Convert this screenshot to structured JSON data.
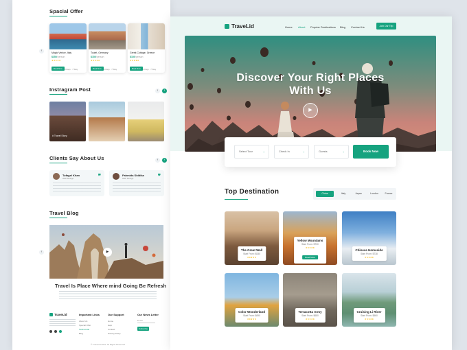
{
  "left": {
    "special_offer": {
      "title": "Spacial Offer",
      "cards": [
        {
          "name": "Magic Venice, Italy",
          "price": "$350",
          "per": "/person",
          "button": "Book Now",
          "meta": "4 Days · 7 Stay"
        },
        {
          "name": "Toulet, Germany",
          "price": "$150",
          "per": "/person",
          "button": "Book Now",
          "meta": "4 Days · 7 Stay"
        },
        {
          "name": "Greek Cottage, Greece",
          "price": "$150",
          "per": "/person",
          "button": "Book Now",
          "meta": "4 Days · 7 Stay"
        }
      ]
    },
    "instagram": {
      "title": "Instragram Post",
      "first_label": "# Travel Story"
    },
    "clients": {
      "title": "Clients Say About Us",
      "items": [
        {
          "name": "Tufagel Khan",
          "role": "Web Design"
        },
        {
          "name": "Fahmida Siddika",
          "role": "Web Design"
        }
      ]
    },
    "blog": {
      "title": "Travel Blog",
      "post_title": "Travel Is Place Where mind Going Be Refresh"
    },
    "footer": {
      "brand": "TraveLid",
      "columns": [
        {
          "title": "Important Links",
          "links": [
            "About Us",
            "Special Offer",
            "Testimonial",
            "Blog"
          ]
        },
        {
          "title": "Our Support",
          "links": [
            "Home",
            "Help",
            "Contact",
            "Privacy Policy"
          ]
        },
        {
          "title": "Our News Letter",
          "input_placeholder": "Email",
          "button": "Subscribe"
        }
      ],
      "copyright": "© TraveLid 2021. All Rights Reserved"
    }
  },
  "right": {
    "brand": "TraveLid",
    "nav": [
      "Home",
      "About",
      "Popular Destinations",
      "Blog",
      "Contact Us"
    ],
    "nav_active": "About",
    "nav_cta": "Join Our Trip",
    "hero_line1": "Discover Your Right Places",
    "hero_line2": "With Us",
    "search": {
      "fields": [
        "Select Tour",
        "Check In",
        "Guests"
      ],
      "button": "Book Now"
    },
    "top_destination": {
      "title": "Top Destination",
      "tabs": [
        "China",
        "Italy",
        "Japan",
        "London",
        "France"
      ],
      "active_tab": "China",
      "cards": [
        {
          "name": "The Great Wall",
          "price": "Start From: $530"
        },
        {
          "name": "Yellow Mountains",
          "price": "Start From: $730",
          "button": "Read More"
        },
        {
          "name": "Chinese Homeside",
          "price": "Start From: $738"
        },
        {
          "name": "Color Wonderland",
          "price": "Start From: $690"
        },
        {
          "name": "Terracotta Army",
          "price": "Start From: $680"
        },
        {
          "name": "Cruising Li River",
          "price": "Start From: $560"
        }
      ]
    }
  },
  "colors": {
    "accent": "#16a37f",
    "star": "#f5b400"
  }
}
